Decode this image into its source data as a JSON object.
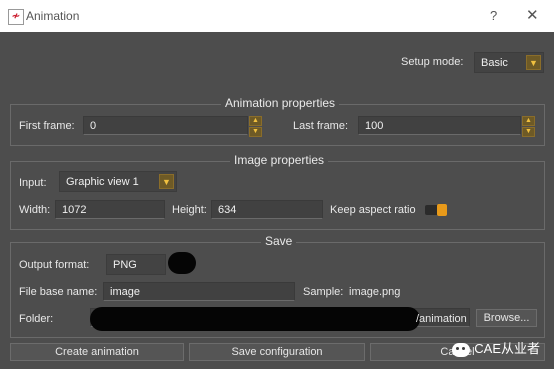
{
  "window": {
    "title": "Animation",
    "help_glyph": "?",
    "close_glyph": "✕",
    "app_icon_glyph": "≁"
  },
  "setup": {
    "label": "Setup mode:",
    "value": "Basic"
  },
  "animation_properties": {
    "title": "Animation properties",
    "first_frame_label": "First frame:",
    "first_frame_value": "0",
    "last_frame_label": "Last frame:",
    "last_frame_value": "100"
  },
  "image_properties": {
    "title": "Image properties",
    "input_label": "Input:",
    "input_value": "Graphic view 1",
    "width_label": "Width:",
    "width_value": "1072",
    "height_label": "Height:",
    "height_value": "634",
    "aspect_label": "Keep aspect ratio",
    "aspect_ratio_on": true
  },
  "save": {
    "title": "Save",
    "output_format_label": "Output format:",
    "output_format_value": "PNG",
    "file_base_label": "File base name:",
    "file_base_value": "image",
    "sample_label": "Sample:",
    "sample_value": "image.png",
    "folder_label": "Folder:",
    "folder_suffix": "/animation",
    "browse_label": "Browse..."
  },
  "buttons": {
    "create": "Create animation",
    "save_config": "Save configuration",
    "cancel": "Cancel"
  },
  "watermark": {
    "text": "CAE从业者"
  },
  "colors": {
    "accent": "#e89a1a",
    "background": "#4d4d4d",
    "field": "#414141"
  }
}
